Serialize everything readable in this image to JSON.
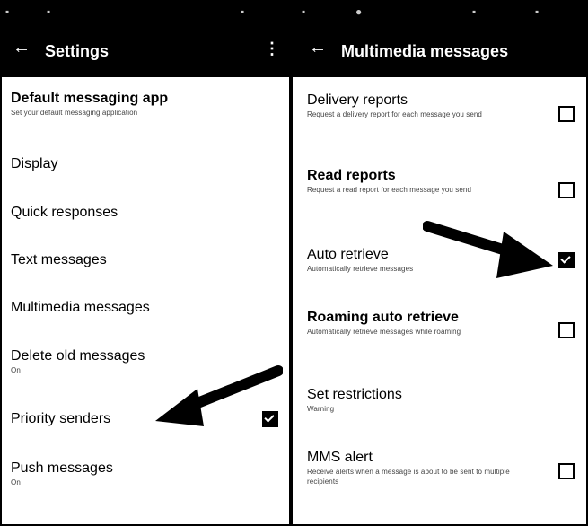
{
  "left": {
    "header": {
      "back_icon": "back-arrow-icon",
      "title": "Settings",
      "overflow_icon": "more-vert-icon"
    },
    "items": [
      {
        "title": "Default messaging app",
        "subtitle": "Set your default messaging application"
      },
      {
        "title": "Display"
      },
      {
        "title": "Quick responses"
      },
      {
        "title": "Text messages"
      },
      {
        "title": "Multimedia messages"
      },
      {
        "title": "Delete old messages",
        "subtitle": "On"
      },
      {
        "title": "Priority senders",
        "checked": true
      },
      {
        "title": "Push messages",
        "subtitle": "On"
      }
    ]
  },
  "right": {
    "header": {
      "back_icon": "back-arrow-icon",
      "title": "Multimedia messages"
    },
    "items": [
      {
        "title": "Delivery reports",
        "subtitle": "Request a delivery report for each message you send",
        "checked": false
      },
      {
        "title": "Read reports",
        "subtitle": "Request a read report for each message you send",
        "checked": false
      },
      {
        "title": "Auto retrieve",
        "subtitle": "Automatically retrieve messages",
        "checked": true
      },
      {
        "title": "Roaming auto retrieve",
        "subtitle": "Automatically retrieve messages while roaming",
        "checked": false
      },
      {
        "title": "Set restrictions",
        "subtitle": "Warning"
      },
      {
        "title": "MMS alert",
        "subtitle": "Receive alerts when a message is about to be sent to multiple recipients",
        "checked": false
      }
    ]
  }
}
